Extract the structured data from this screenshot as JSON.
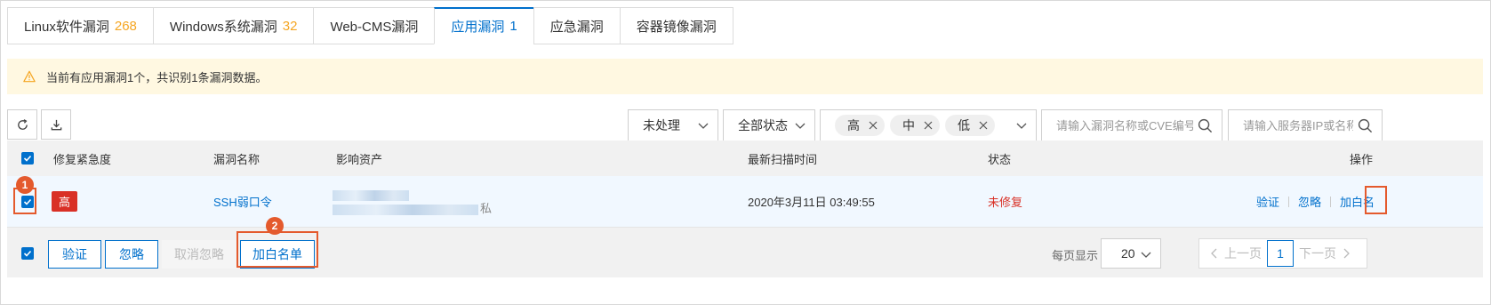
{
  "tabs": [
    {
      "label": "Linux软件漏洞",
      "count": "268"
    },
    {
      "label": "Windows系统漏洞",
      "count": "32"
    },
    {
      "label": "Web-CMS漏洞",
      "count": ""
    },
    {
      "label": "应用漏洞",
      "count": "1",
      "active": true
    },
    {
      "label": "应急漏洞",
      "count": ""
    },
    {
      "label": "容器镜像漏洞",
      "count": ""
    }
  ],
  "notice": {
    "text": "当前有应用漏洞1个，共识别1条漏洞数据。",
    "icon": "warning-icon"
  },
  "toolbar": {
    "refresh_icon": "refresh-icon",
    "download_icon": "download-icon",
    "status_filter": "未处理",
    "all_status_filter": "全部状态",
    "severity_tags": [
      "高",
      "中",
      "低"
    ],
    "search_vuln_placeholder": "请输入漏洞名称或CVE编号",
    "search_server_placeholder": "请输入服务器IP或名称"
  },
  "table": {
    "headers": {
      "urgency": "修复紧急度",
      "name": "漏洞名称",
      "asset": "影响资产",
      "scan_time": "最新扫描时间",
      "status": "状态",
      "actions": "操作"
    },
    "rows": [
      {
        "severity": "高",
        "name": "SSH弱口令",
        "asset_suffix": "私",
        "scan_time": "2020年3月11日 03:49:55",
        "status": "未修复",
        "actions": {
          "verify": "验证",
          "ignore": "忽略",
          "whitelist": "加白名单",
          "whitelist_visible": "加白名"
        }
      }
    ]
  },
  "footer": {
    "verify": "验证",
    "ignore": "忽略",
    "unignore": "取消忽略",
    "whitelist": "加白名单",
    "per_page_label": "每页显示",
    "per_page_value": "20",
    "prev": "上一页",
    "current_page": "1",
    "next": "下一页"
  },
  "annotations": {
    "step1": "1",
    "step2": "2"
  },
  "colors": {
    "accent": "#0070cc",
    "danger": "#d93026",
    "warning": "#f5a623",
    "highlight": "#e45a2d",
    "notice_bg": "#fff8e1"
  }
}
